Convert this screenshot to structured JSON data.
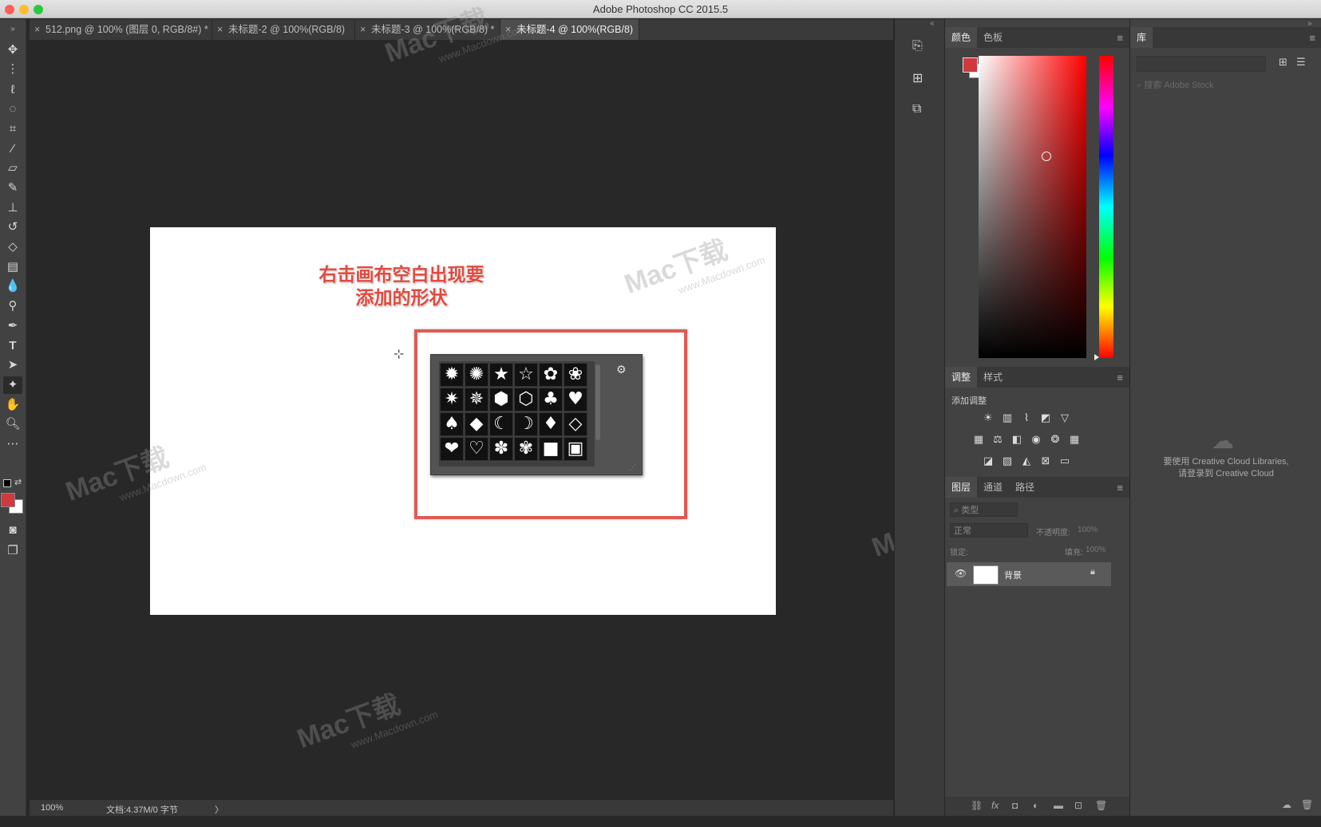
{
  "window": {
    "title": "Adobe Photoshop CC 2015.5"
  },
  "tabs": [
    {
      "label": "512.png @ 100% (图层 0, RGB/8#) *",
      "active": false
    },
    {
      "label": "未标题-2 @ 100%(RGB/8)",
      "active": false
    },
    {
      "label": "未标题-3 @ 100%(RGB/8) *",
      "active": false
    },
    {
      "label": "未标题-4 @ 100%(RGB/8)",
      "active": true
    }
  ],
  "tab_close_glyph": "×",
  "annotation": {
    "line1": "右击画布空白出现要",
    "line2": "添加的形状",
    "color": "#e04a3f"
  },
  "highlight_box_color": "#e05a52",
  "shape_picker": {
    "shapes": [
      [
        "burst-12-icon",
        "burst-16-icon",
        "star-5-icon",
        "star-5-outline-icon",
        "seal-icon",
        "seal-outline-icon"
      ],
      [
        "burst-24-icon",
        "burst-ring-icon",
        "hexagon-icon",
        "hexagon-outline-icon",
        "club-icon",
        "heart-icon"
      ],
      [
        "spade-icon",
        "diamond-icon",
        "crescent-icon",
        "crescent-outline-icon",
        "diamond-suit-icon",
        "diamond-outline-icon"
      ],
      [
        "heart-bold-icon",
        "heart-outline-icon",
        "flower-icon",
        "flower-outline-icon",
        "rounded-square-icon",
        "square-frame-icon"
      ]
    ],
    "gear_glyph": "⚙"
  },
  "status_bar": {
    "zoom": "100%",
    "doc_info": "文档:4.37M/0 字节",
    "arrow": "〉"
  },
  "color_panel": {
    "tabs": [
      "颜色",
      "色板"
    ],
    "foreground": "#d0393e",
    "background": "#ffffff",
    "hue": "#ff0000"
  },
  "adjust_panel": {
    "tabs": [
      "调整",
      "样式"
    ],
    "heading": "添加调整"
  },
  "layers_panel": {
    "tabs": [
      "图层",
      "通道",
      "路径"
    ],
    "filter_placeholder": "类型",
    "blend_mode": "正常",
    "opacity_label": "不透明度:",
    "opacity_value": "100%",
    "lock_label": "锁定:",
    "fill_label": "填充:",
    "fill_value": "100%",
    "layers": [
      {
        "name": "背景",
        "visible": true,
        "locked": true
      }
    ]
  },
  "library_panel": {
    "tab": "库",
    "search_placeholder": "搜索 Adobe Stock",
    "message_line1": "要使用 Creative Cloud Libraries,",
    "message_line2": "请登录到 Creative Cloud"
  },
  "watermark": {
    "brand": "Mac下载",
    "site": "www.Macdown.com"
  }
}
